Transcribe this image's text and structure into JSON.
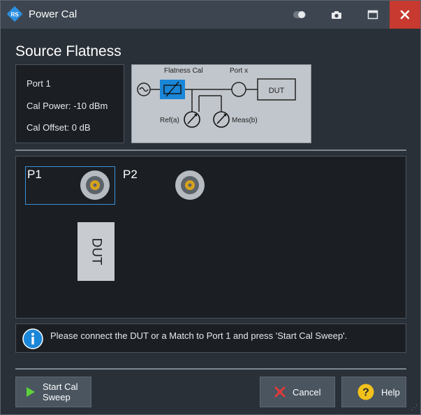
{
  "window": {
    "title": "Power Cal"
  },
  "heading": "Source Flatness",
  "info": {
    "port": "Port 1",
    "cal_power": "Cal Power:  -10 dBm",
    "cal_offset": "Cal Offset:  0 dB"
  },
  "diagram": {
    "flatness_cal_label": "Flatness Cal",
    "port_x_label": "Port x",
    "dut_label": "DUT",
    "ref_label": "Ref(a)",
    "meas_label": "Meas(b)"
  },
  "ports": {
    "p1": "P1",
    "p2": "P2",
    "dut": "DUT"
  },
  "message": "Please connect the DUT or a Match to Port 1 and press 'Start Cal Sweep'.",
  "buttons": {
    "start_line1": "Start Cal",
    "start_line2": "Sweep",
    "cancel": "Cancel",
    "help": "Help"
  },
  "colors": {
    "title_bar": "#3d4650",
    "close_red": "#c83a2f",
    "accent_blue": "#1a86d8",
    "connector_gold": "#d7a21d",
    "help_yellow": "#f2c21a",
    "start_green": "#5bd13a",
    "cancel_red": "#e03a3a"
  }
}
